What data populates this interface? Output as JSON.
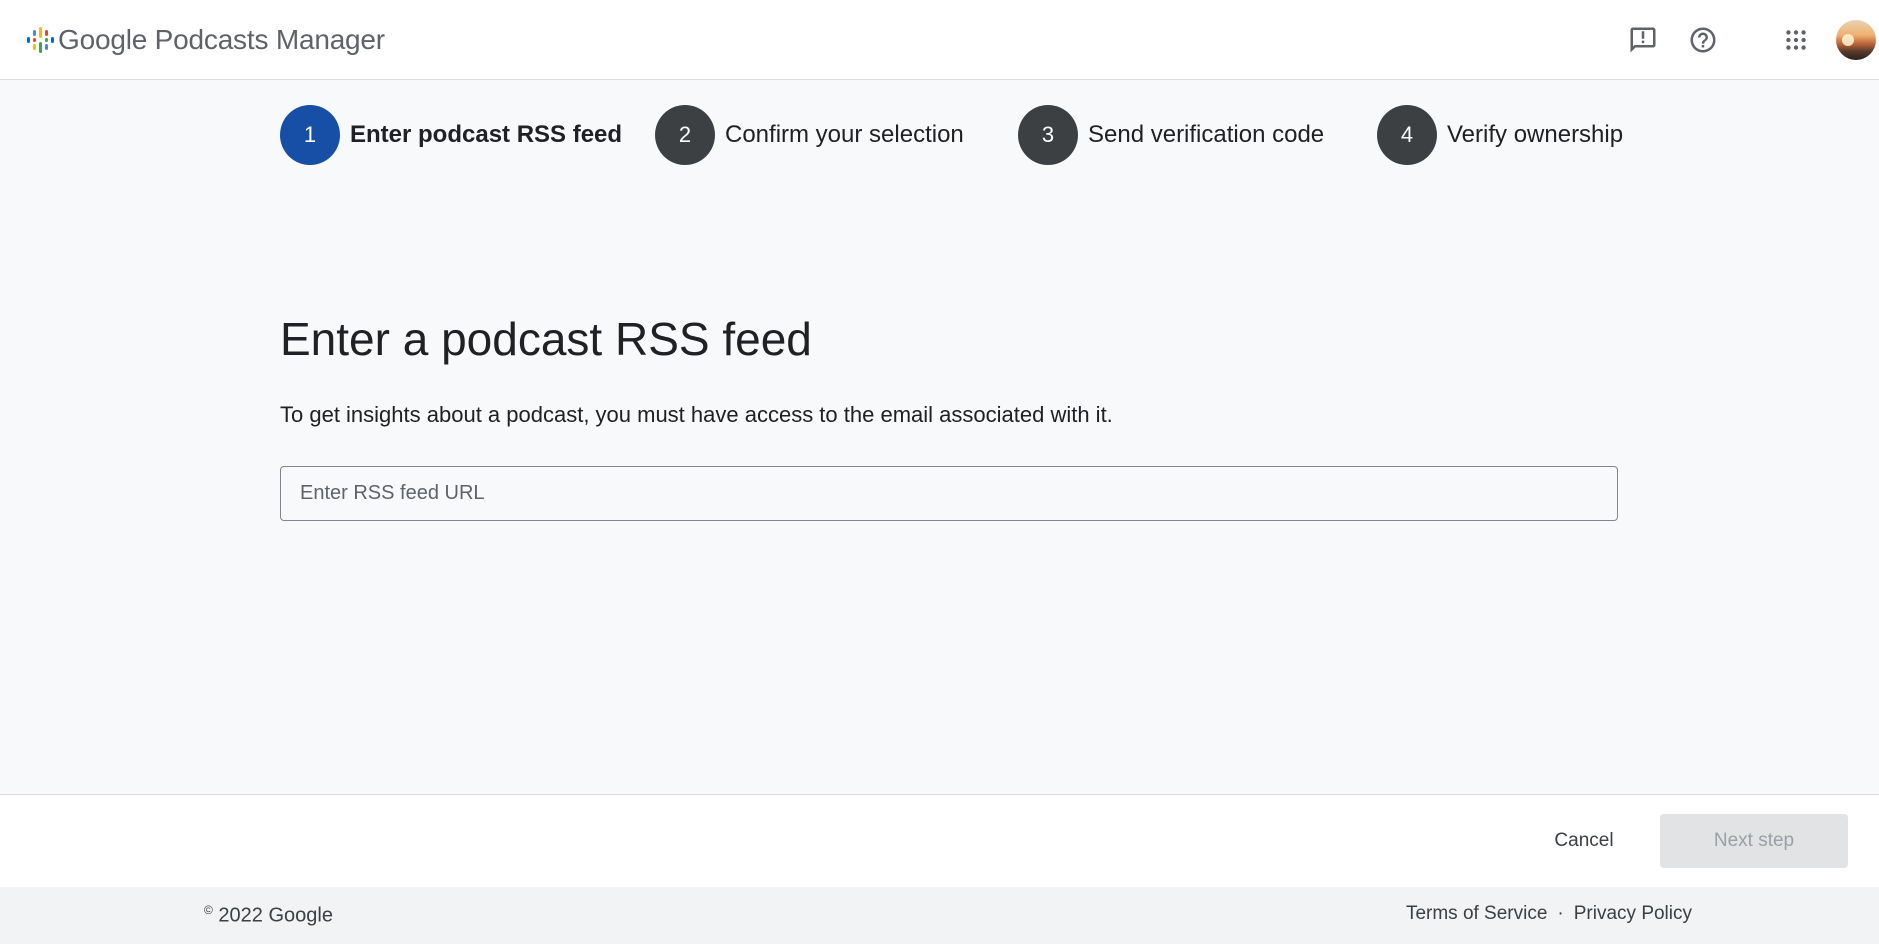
{
  "app": {
    "title": "Google Podcasts Manager"
  },
  "header": {
    "icons": {
      "feedback": "feedback-icon",
      "help": "help-icon",
      "apps": "apps-grid-icon",
      "avatar": "user-avatar"
    }
  },
  "stepper": {
    "steps": [
      {
        "number": "1",
        "label": "Enter podcast RSS feed",
        "state": "active"
      },
      {
        "number": "2",
        "label": "Confirm your selection",
        "state": "upcoming"
      },
      {
        "number": "3",
        "label": "Send verification code",
        "state": "upcoming"
      },
      {
        "number": "4",
        "label": "Verify ownership",
        "state": "upcoming"
      }
    ]
  },
  "main": {
    "title": "Enter a podcast RSS feed",
    "description": "To get insights about a podcast, you must have access to the email associated with it.",
    "rss_input": {
      "placeholder": "Enter RSS feed URL",
      "value": ""
    }
  },
  "actions": {
    "cancel_label": "Cancel",
    "next_label": "Next step",
    "next_enabled": false
  },
  "footer": {
    "copyright_symbol": "©",
    "copyright_text": "2022 Google",
    "terms_label": "Terms of Service",
    "separator": "·",
    "privacy_label": "Privacy Policy"
  },
  "colors": {
    "accent": "#174ea6",
    "step_inactive": "#3c4043",
    "background": "#f8f9fa",
    "footer_bg": "#f1f3f4",
    "disabled_button_bg": "#e2e3e5"
  }
}
